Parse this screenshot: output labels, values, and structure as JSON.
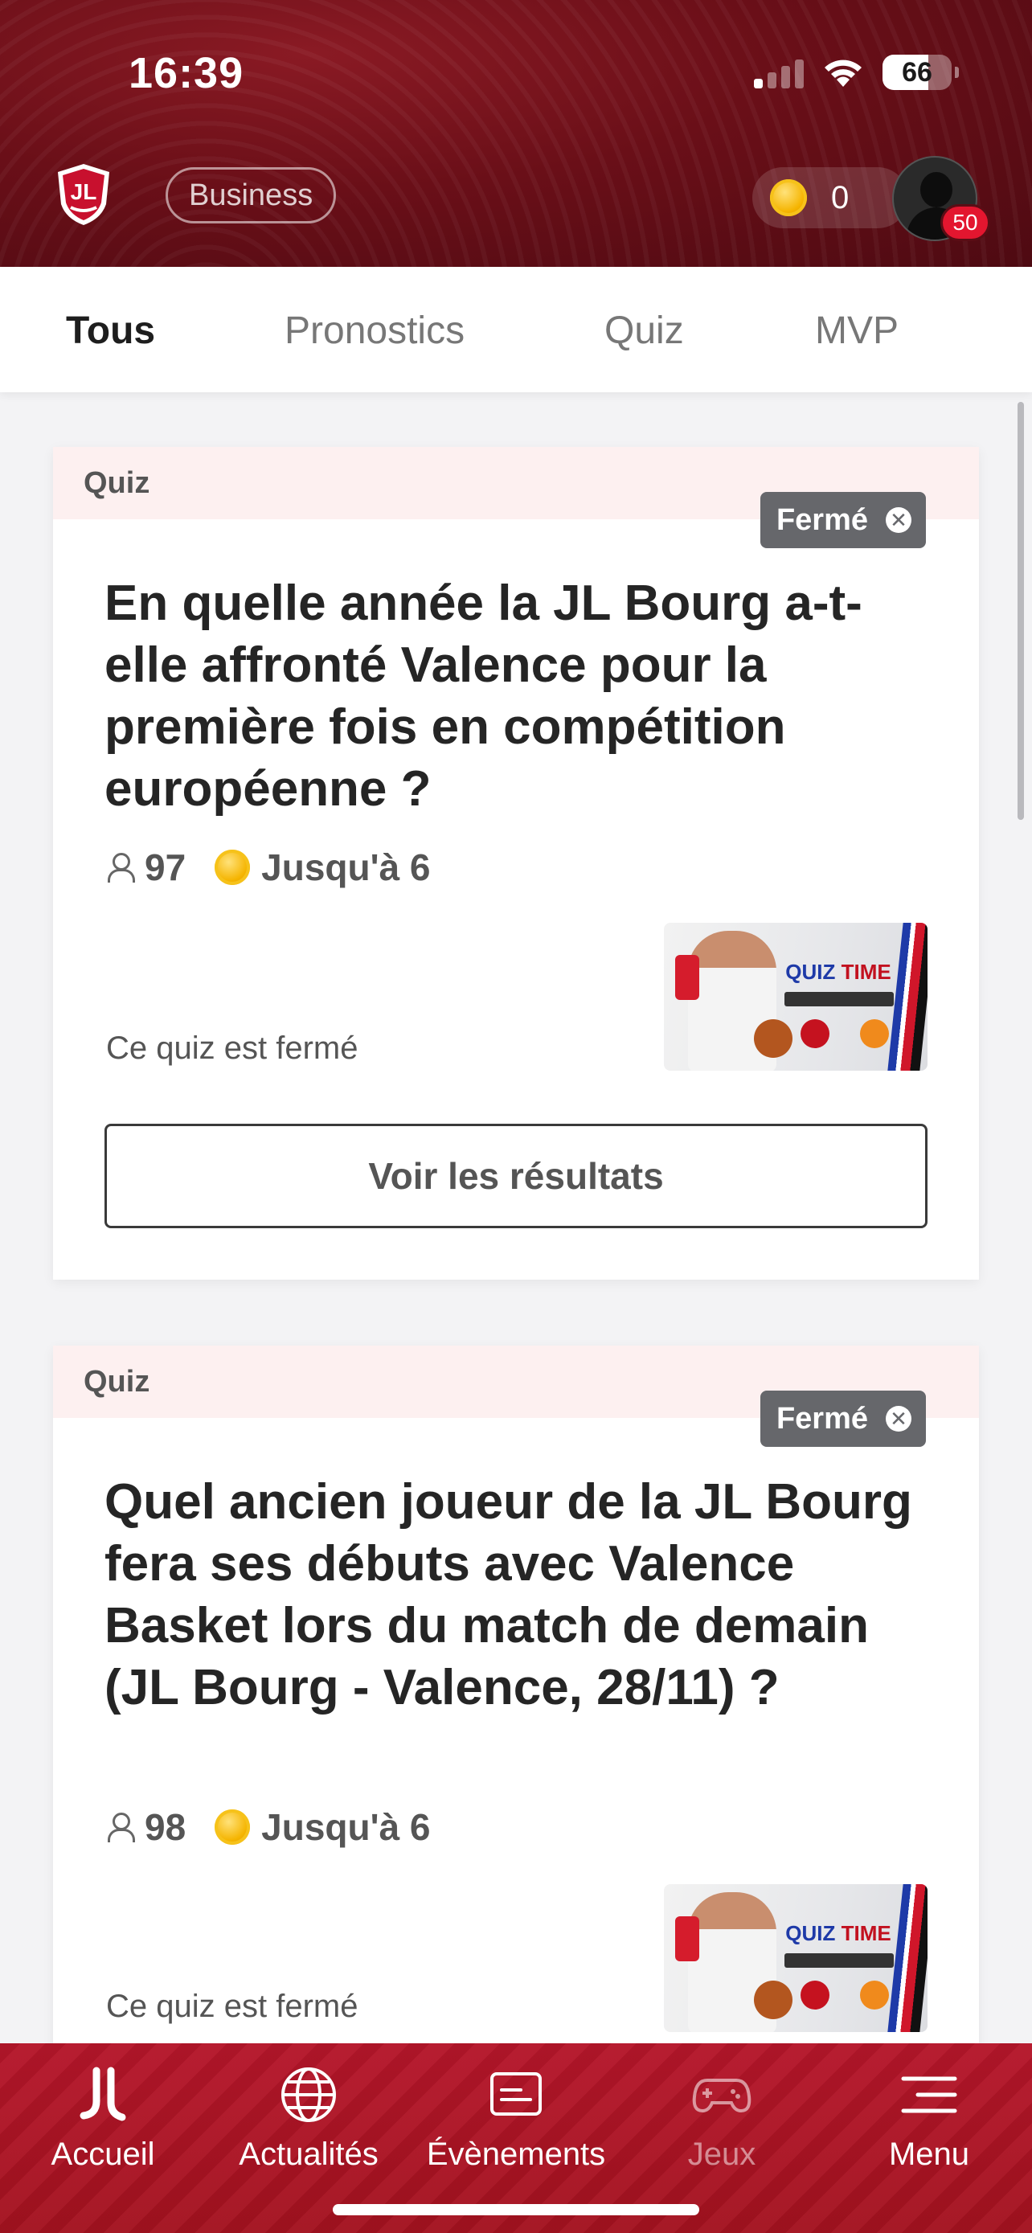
{
  "status_bar": {
    "time": "16:39",
    "battery": "66"
  },
  "header": {
    "business_label": "Business",
    "coins": "0",
    "notification_count": "50"
  },
  "tabs": [
    {
      "label": "Tous",
      "active": true
    },
    {
      "label": "Pronostics",
      "active": false
    },
    {
      "label": "Quiz",
      "active": false
    },
    {
      "label": "MVP",
      "active": false
    }
  ],
  "cards": [
    {
      "category": "Quiz",
      "status": "Fermé",
      "question": "En quelle année la JL Bourg a-t-elle affronté Valence pour la première fois en compétition européenne ?",
      "participants": "97",
      "reward": "Jusqu'à 6",
      "closed_text": "Ce quiz est fermé",
      "results_label": "Voir les résultats",
      "thumb": {
        "title_a": "QUIZ",
        "title_b": "TIME"
      }
    },
    {
      "category": "Quiz",
      "status": "Fermé",
      "question": "Quel ancien joueur de la JL Bourg fera ses débuts avec Valence Basket lors du match de demain (JL Bourg - Valence, 28/11) ?",
      "participants": "98",
      "reward": "Jusqu'à 6",
      "closed_text": "Ce quiz est fermé",
      "thumb": {
        "title_a": "QUIZ",
        "title_b": "TIME"
      }
    }
  ],
  "bottom_nav": [
    {
      "label": "Accueil",
      "icon": "jl-logo-icon",
      "enabled": true
    },
    {
      "label": "Actualités",
      "icon": "globe-icon",
      "enabled": true
    },
    {
      "label": "Évènements",
      "icon": "event-card-icon",
      "enabled": true
    },
    {
      "label": "Jeux",
      "icon": "gamepad-icon",
      "enabled": false
    },
    {
      "label": "Menu",
      "icon": "menu-icon",
      "enabled": true
    }
  ],
  "colors": {
    "brand_dark": "#6a0f18",
    "brand_red": "#b5162a",
    "badge_red": "#e3162f",
    "closed_badge": "#66676b"
  }
}
